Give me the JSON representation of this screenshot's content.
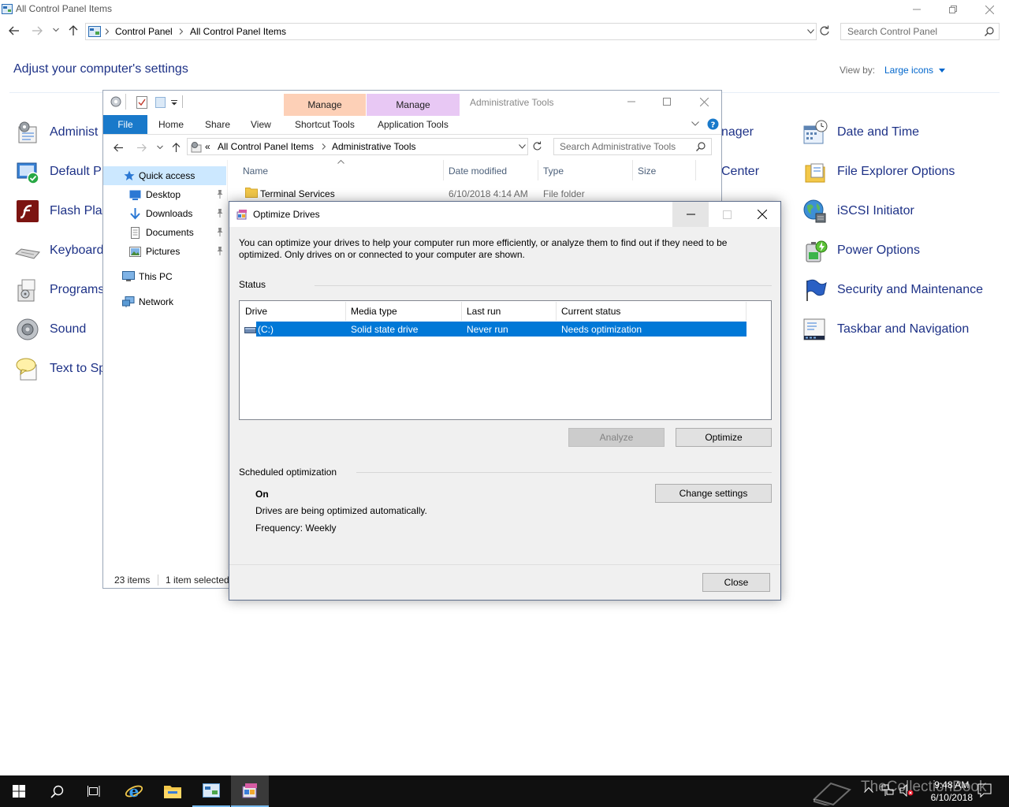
{
  "control_panel": {
    "window_title": "All Control Panel Items",
    "breadcrumb": [
      "Control Panel",
      "All Control Panel Items"
    ],
    "search_placeholder": "Search Control Panel",
    "heading": "Adjust your computer's settings",
    "view_by_label": "View by:",
    "view_by_value": "Large icons",
    "left_items": [
      "Administrative Tools",
      "Default Programs",
      "Flash Player",
      "Keyboard",
      "Programs and Features",
      "Sound",
      "Text to Speech"
    ],
    "left_items_visible": [
      "Administ",
      "Default Pr",
      "Flash Play",
      "Keyboard",
      "Programs",
      "Sound",
      "Text to Spe"
    ],
    "middle_items_visible": [
      "nager",
      "Center"
    ],
    "right_items": [
      "Date and Time",
      "File Explorer Options",
      "iSCSI Initiator",
      "Power Options",
      "Security and Maintenance",
      "Taskbar and Navigation"
    ]
  },
  "explorer": {
    "window_title": "Administrative Tools",
    "contextual_tabs": [
      "Manage",
      "Manage"
    ],
    "ribbon_tabs": [
      "File",
      "Home",
      "Share",
      "View",
      "Shortcut Tools",
      "Application Tools"
    ],
    "breadcrumb_prefix": "«",
    "breadcrumb": [
      "All Control Panel Items",
      "Administrative Tools"
    ],
    "search_placeholder": "Search Administrative Tools",
    "nav": {
      "quick_access": "Quick access",
      "pinned": [
        "Desktop",
        "Downloads",
        "Documents",
        "Pictures"
      ],
      "this_pc": "This PC",
      "network": "Network"
    },
    "columns": [
      "Name",
      "Date modified",
      "Type",
      "Size"
    ],
    "rows": [
      {
        "name": "Terminal Services",
        "date": "6/10/2018 4:14 AM",
        "type": "File folder"
      }
    ],
    "status_items": "23 items",
    "status_selected": "1 item selected"
  },
  "optimize_drives": {
    "title": "Optimize Drives",
    "intro": "You can optimize your drives to help your computer run more efficiently, or analyze them to find out if they need to be optimized. Only drives on or connected to your computer are shown.",
    "status_label": "Status",
    "columns": [
      "Drive",
      "Media type",
      "Last run",
      "Current status"
    ],
    "drives": [
      {
        "drive": "(C:)",
        "media_type": "Solid state drive",
        "last_run": "Never run",
        "current_status": "Needs optimization"
      }
    ],
    "analyze_label": "Analyze",
    "optimize_label": "Optimize",
    "scheduled_label": "Scheduled optimization",
    "schedule_state": "On",
    "schedule_desc": "Drives are being optimized automatically.",
    "frequency": "Frequency: Weekly",
    "change_settings_label": "Change settings",
    "close_label": "Close"
  },
  "taskbar": {
    "time": "9:48 AM",
    "date": "6/10/2018",
    "watermark": "TheCollectionBook"
  },
  "colors": {
    "link_blue": "#1e3287",
    "selection": "#0078d7",
    "manage_shortcut": "#fdd0b7",
    "manage_application": "#e8c8f4",
    "file_tab": "#1979ca"
  }
}
